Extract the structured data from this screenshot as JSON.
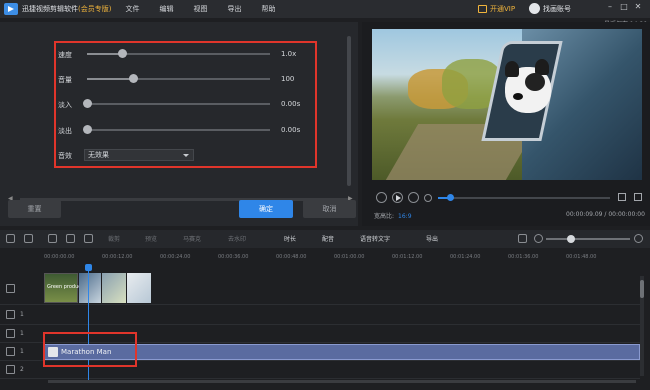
{
  "titlebar": {
    "app_name": "迅捷视频剪辑软件",
    "edition": "(会员专版)",
    "menu": [
      "文件",
      "编辑",
      "视图",
      "导出",
      "帮助"
    ],
    "vip_label": "开通VIP",
    "account_label": "找画账号"
  },
  "save_info": "最近保存 14:20",
  "properties": {
    "speed_label": "速度",
    "speed_value": "1.0x",
    "speed_level": 0.19,
    "volume_label": "音量",
    "volume_value": "100",
    "volume_level": 0.25,
    "fade_in_label": "淡入",
    "fade_in_value": "0.00s",
    "fade_in_level": 0.0,
    "fade_out_label": "淡出",
    "fade_out_value": "0.00s",
    "fade_out_level": 0.0,
    "effect_label": "音效",
    "effect_value": "无效果"
  },
  "buttons": {
    "reset": "重置",
    "ok": "确定",
    "cancel": "取消"
  },
  "player": {
    "progress": 0.07,
    "ratio_label": "宽高比:",
    "ratio_value": "16:9",
    "timecode": "00:00:09.09 / 00:00:00:00"
  },
  "toolbar": {
    "items": [
      "裁剪",
      "预览",
      "马赛克",
      "去水印",
      "时长",
      "配音",
      "语音转文字",
      "导出"
    ],
    "zoom_level": 0.3
  },
  "timeline": {
    "ticks": [
      "00:00:00.00",
      "00:00:12.00",
      "00:00:24.00",
      "00:00:36.00",
      "00:00:48.00",
      "00:01:00.00",
      "00:01:12.00",
      "00:01:24.00",
      "00:01:36.00",
      "00:01:48.00"
    ],
    "tracks": [
      {
        "num": ""
      },
      {
        "num": "1"
      },
      {
        "num": "1"
      },
      {
        "num": "1"
      },
      {
        "num": "2"
      }
    ],
    "audio_clip_name": "Marathon Man",
    "thumb_caption": "Green production"
  },
  "colors": {
    "accent": "#2f86e8",
    "highlight_box": "#e0352b",
    "vip": "#f0b43c",
    "audio_clip": "#5a6ba0"
  }
}
